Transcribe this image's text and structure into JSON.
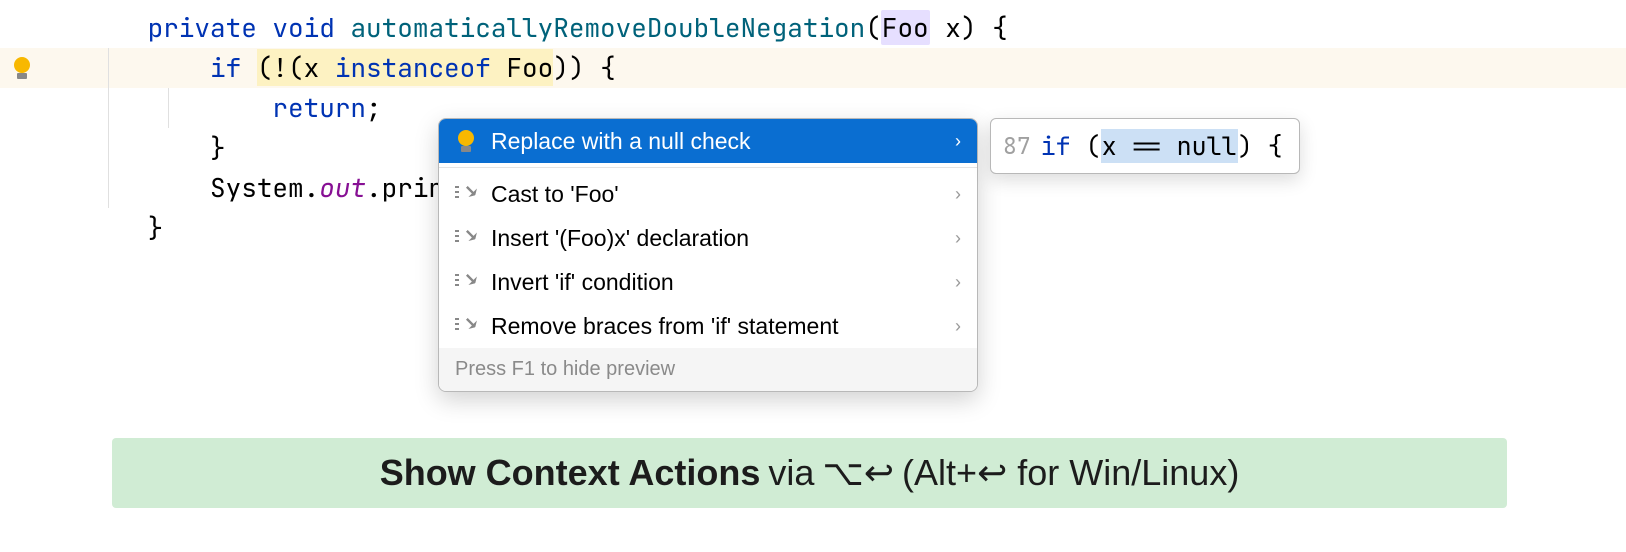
{
  "code": {
    "l1": {
      "kw1": "private",
      "kw2": "void",
      "method": "automaticallyRemoveDoubleNegation",
      "open": "(",
      "ptype": "Foo",
      "pname": " x",
      "close": ") {"
    },
    "l2": {
      "pre": "    ",
      "kw_if": "if ",
      "expr": "(!(x ",
      "inst": "instanceof",
      "type": " Foo",
      "after": ")) {"
    },
    "l3": {
      "pre": "        ",
      "kw": "return",
      "semi": ";"
    },
    "l4": {
      "pre": "    ",
      "brace": "}"
    },
    "l5": {
      "pre": "    ",
      "sys": "System.",
      "out": "out",
      "rest": ".println(x)"
    },
    "l6": {
      "brace": "}"
    }
  },
  "popup": {
    "items": [
      {
        "icon": "bulb",
        "label": "Replace with a null check",
        "selected": true
      },
      {
        "icon": "edit",
        "label": "Cast to 'Foo'",
        "selected": false
      },
      {
        "icon": "edit",
        "label": "Insert '(Foo)x' declaration",
        "selected": false
      },
      {
        "icon": "edit",
        "label": "Invert 'if' condition",
        "selected": false
      },
      {
        "icon": "edit",
        "label": "Remove braces from 'if' statement",
        "selected": false
      }
    ],
    "hint": "Press F1 to hide preview"
  },
  "preview": {
    "line_no": "87",
    "kw_if": "if ",
    "open": "(",
    "expr": "x == null",
    "close": ") {"
  },
  "tip": {
    "bold": "Show Context Actions",
    "via": " via ",
    "mac_key": "⌥↩",
    "rest": " (Alt+↩ for Win/Linux)"
  }
}
